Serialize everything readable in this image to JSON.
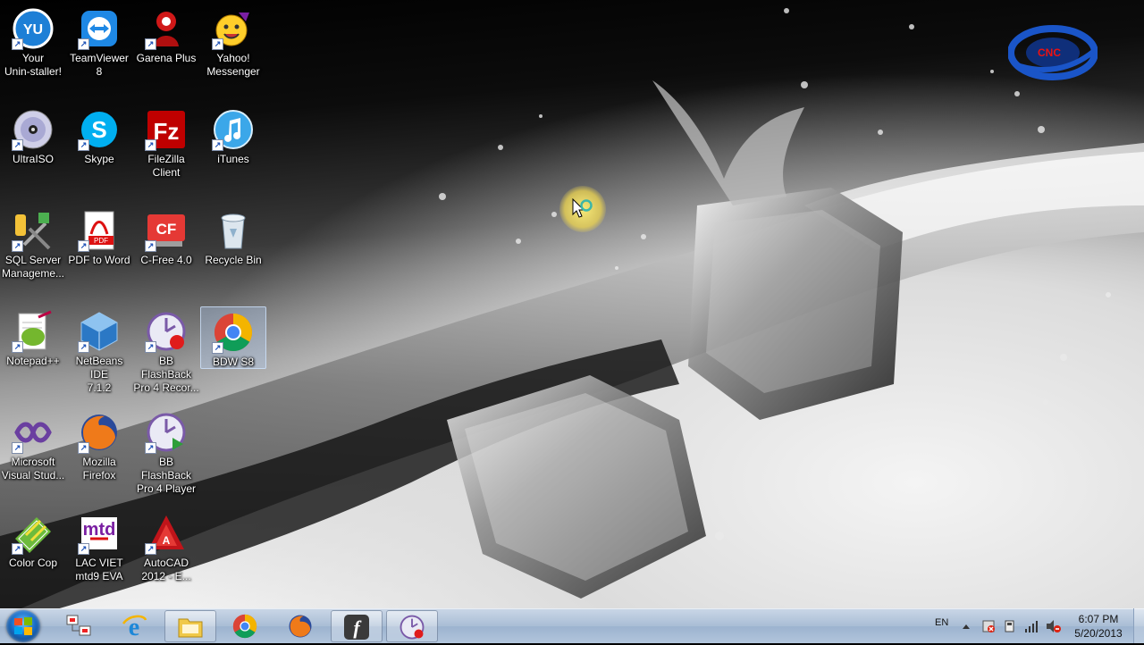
{
  "desktop": {
    "icons": [
      {
        "name": "your-uninstaller-icon",
        "label": "Your\nUnin-staller!",
        "icon": "your-uninstaller"
      },
      {
        "name": "teamviewer-icon",
        "label": "TeamViewer\n8",
        "icon": "teamviewer"
      },
      {
        "name": "garena-plus-icon",
        "label": "Garena Plus",
        "icon": "garena"
      },
      {
        "name": "yahoo-messenger-icon",
        "label": "Yahoo!\nMessenger",
        "icon": "yahoo"
      },
      {
        "name": "ultraiso-icon",
        "label": "UltraISO",
        "icon": "disc"
      },
      {
        "name": "skype-icon",
        "label": "Skype",
        "icon": "skype"
      },
      {
        "name": "filezilla-icon",
        "label": "FileZilla\nClient",
        "icon": "filezilla"
      },
      {
        "name": "itunes-icon",
        "label": "iTunes",
        "icon": "itunes"
      },
      {
        "name": "sql-server-icon",
        "label": "SQL Server\nManageme...",
        "icon": "sql"
      },
      {
        "name": "pdf-to-word-icon",
        "label": "PDF to Word",
        "icon": "pdf"
      },
      {
        "name": "c-free-icon",
        "label": "C-Free 4.0",
        "icon": "cfree"
      },
      {
        "name": "recycle-bin-icon",
        "label": "Recycle Bin",
        "icon": "recycle"
      },
      {
        "name": "notepad-plus-plus-icon",
        "label": "Notepad++",
        "icon": "notepad"
      },
      {
        "name": "netbeans-icon",
        "label": "NetBeans IDE\n7.1.2",
        "icon": "netbeans"
      },
      {
        "name": "bb-flashback-recorder-icon",
        "label": "BB FlashBack\nPro 4 Recor...",
        "icon": "flashback"
      },
      {
        "name": "bdw-s8-icon",
        "label": "BDW S8",
        "icon": "chrome",
        "selected": true
      },
      {
        "name": "visual-studio-icon",
        "label": "Microsoft\nVisual Stud...",
        "icon": "vs"
      },
      {
        "name": "mozilla-firefox-icon",
        "label": "Mozilla\nFirefox",
        "icon": "firefox"
      },
      {
        "name": "bb-flashback-player-icon",
        "label": "BB FlashBack\nPro 4 Player",
        "icon": "flashback2"
      },
      {
        "name": "color-cop-icon",
        "label": "Color Cop",
        "icon": "colorcop"
      },
      {
        "name": "lac-viet-icon",
        "label": "LAC VIET\nmtd9 EVA",
        "icon": "lacviet"
      },
      {
        "name": "autocad-icon",
        "label": "AutoCAD\n2012 - E...",
        "icon": "autocad"
      }
    ]
  },
  "logo": {
    "text": "CNC",
    "colors": {
      "ring": "#1a55c8",
      "text": "#e11111"
    }
  },
  "taskbar": {
    "buttons": [
      {
        "name": "taskbar-ftp-app-button",
        "icon": "network"
      },
      {
        "name": "taskbar-internet-explorer-button",
        "icon": "ie"
      },
      {
        "name": "taskbar-file-explorer-button",
        "icon": "folder",
        "running": true
      },
      {
        "name": "taskbar-chrome-button",
        "icon": "chrome"
      },
      {
        "name": "taskbar-firefox-button",
        "icon": "firefox"
      },
      {
        "name": "taskbar-flash-button",
        "icon": "flash",
        "running": true
      },
      {
        "name": "taskbar-flashback-recorder-button",
        "icon": "flashback",
        "running": true
      }
    ],
    "tray": {
      "language": "EN",
      "time": "6:07 PM",
      "date": "5/20/2013"
    }
  },
  "colors": {
    "taskbar": "#b2c5dc",
    "selection": "#b4d2fa",
    "label_text": "#ffffff"
  }
}
